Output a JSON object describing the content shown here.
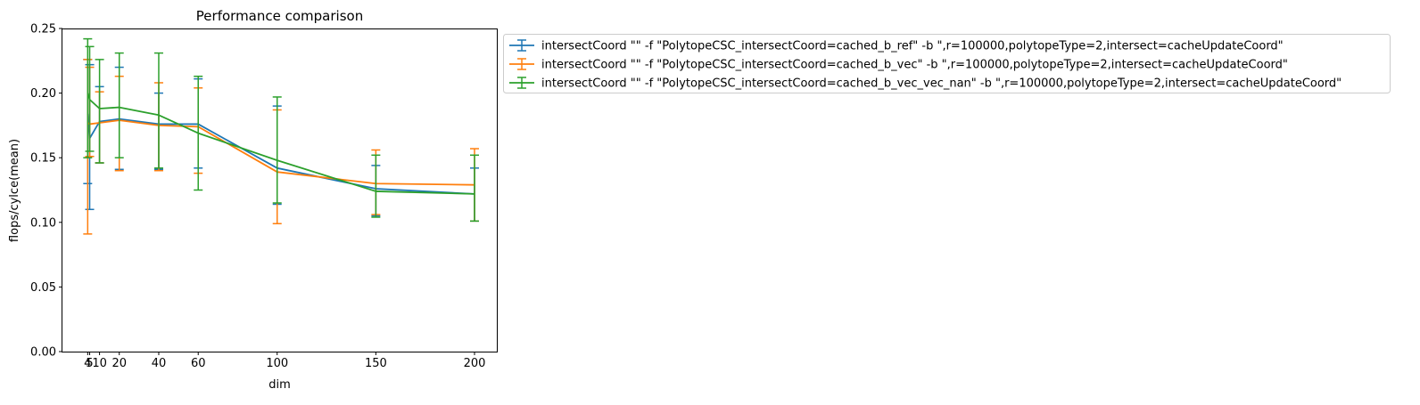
{
  "chart_data": {
    "type": "line",
    "title": "Performance comparison",
    "xlabel": "dim",
    "ylabel": "flops/cylce(mean)",
    "xlim": [
      -8.8,
      211.3
    ],
    "ylim": [
      0,
      0.25
    ],
    "xticks": [
      4,
      5,
      10,
      20,
      40,
      60,
      100,
      150,
      200
    ],
    "xtick_labels": [
      "4",
      "5",
      "10",
      "20",
      "40",
      "60",
      "100",
      "150",
      "200"
    ],
    "yticks": [
      0.0,
      0.05,
      0.1,
      0.15,
      0.2,
      0.25
    ],
    "ytick_labels": [
      "0.00",
      "0.05",
      "0.10",
      "0.15",
      "0.20",
      "0.25"
    ],
    "legend_position": "outside-top-right",
    "grid": false,
    "series": [
      {
        "name": "intersectCoord \"\" -f \"PolytopeCSC_intersectCoord=cached_b_ref\" -b \",r=100000,polytopeType=2,intersect=cacheUpdateCoord\"",
        "color": "#1f77b4",
        "x": [
          4,
          5,
          10,
          20,
          40,
          60,
          100,
          150,
          200
        ],
        "y": [
          0.184,
          0.165,
          0.178,
          0.18,
          0.176,
          0.176,
          0.142,
          0.126,
          0.122
        ],
        "err_low": [
          0.13,
          0.11,
          0.146,
          0.141,
          0.141,
          0.142,
          0.114,
          0.105,
          0.101
        ],
        "err_high": [
          0.226,
          0.222,
          0.205,
          0.22,
          0.2,
          0.211,
          0.19,
          0.144,
          0.142
        ]
      },
      {
        "name": "intersectCoord \"\" -f \"PolytopeCSC_intersectCoord=cached_b_vec\" -b \",r=100000,polytopeType=2,intersect=cacheUpdateCoord\"",
        "color": "#ff7f0e",
        "x": [
          4,
          5,
          10,
          20,
          40,
          60,
          100,
          150,
          200
        ],
        "y": [
          0.177,
          0.176,
          0.177,
          0.179,
          0.175,
          0.174,
          0.139,
          0.13,
          0.129
        ],
        "err_low": [
          0.091,
          0.151,
          0.146,
          0.14,
          0.14,
          0.138,
          0.099,
          0.106,
          0.101
        ],
        "err_high": [
          0.226,
          0.22,
          0.201,
          0.213,
          0.208,
          0.204,
          0.187,
          0.156,
          0.157
        ]
      },
      {
        "name": "intersectCoord \"\" -f \"PolytopeCSC_intersectCoord=cached_b_vec_vec_nan\" -b \",r=100000,polytopeType=2,intersect=cacheUpdateCoord\"",
        "color": "#2ca02c",
        "x": [
          4,
          5,
          10,
          20,
          40,
          60,
          100,
          150,
          200
        ],
        "y": [
          0.2,
          0.195,
          0.188,
          0.189,
          0.183,
          0.169,
          0.148,
          0.124,
          0.122
        ],
        "err_low": [
          0.15,
          0.155,
          0.146,
          0.15,
          0.142,
          0.125,
          0.115,
          0.104,
          0.101
        ],
        "err_high": [
          0.242,
          0.236,
          0.226,
          0.231,
          0.231,
          0.213,
          0.197,
          0.152,
          0.152
        ]
      }
    ]
  }
}
